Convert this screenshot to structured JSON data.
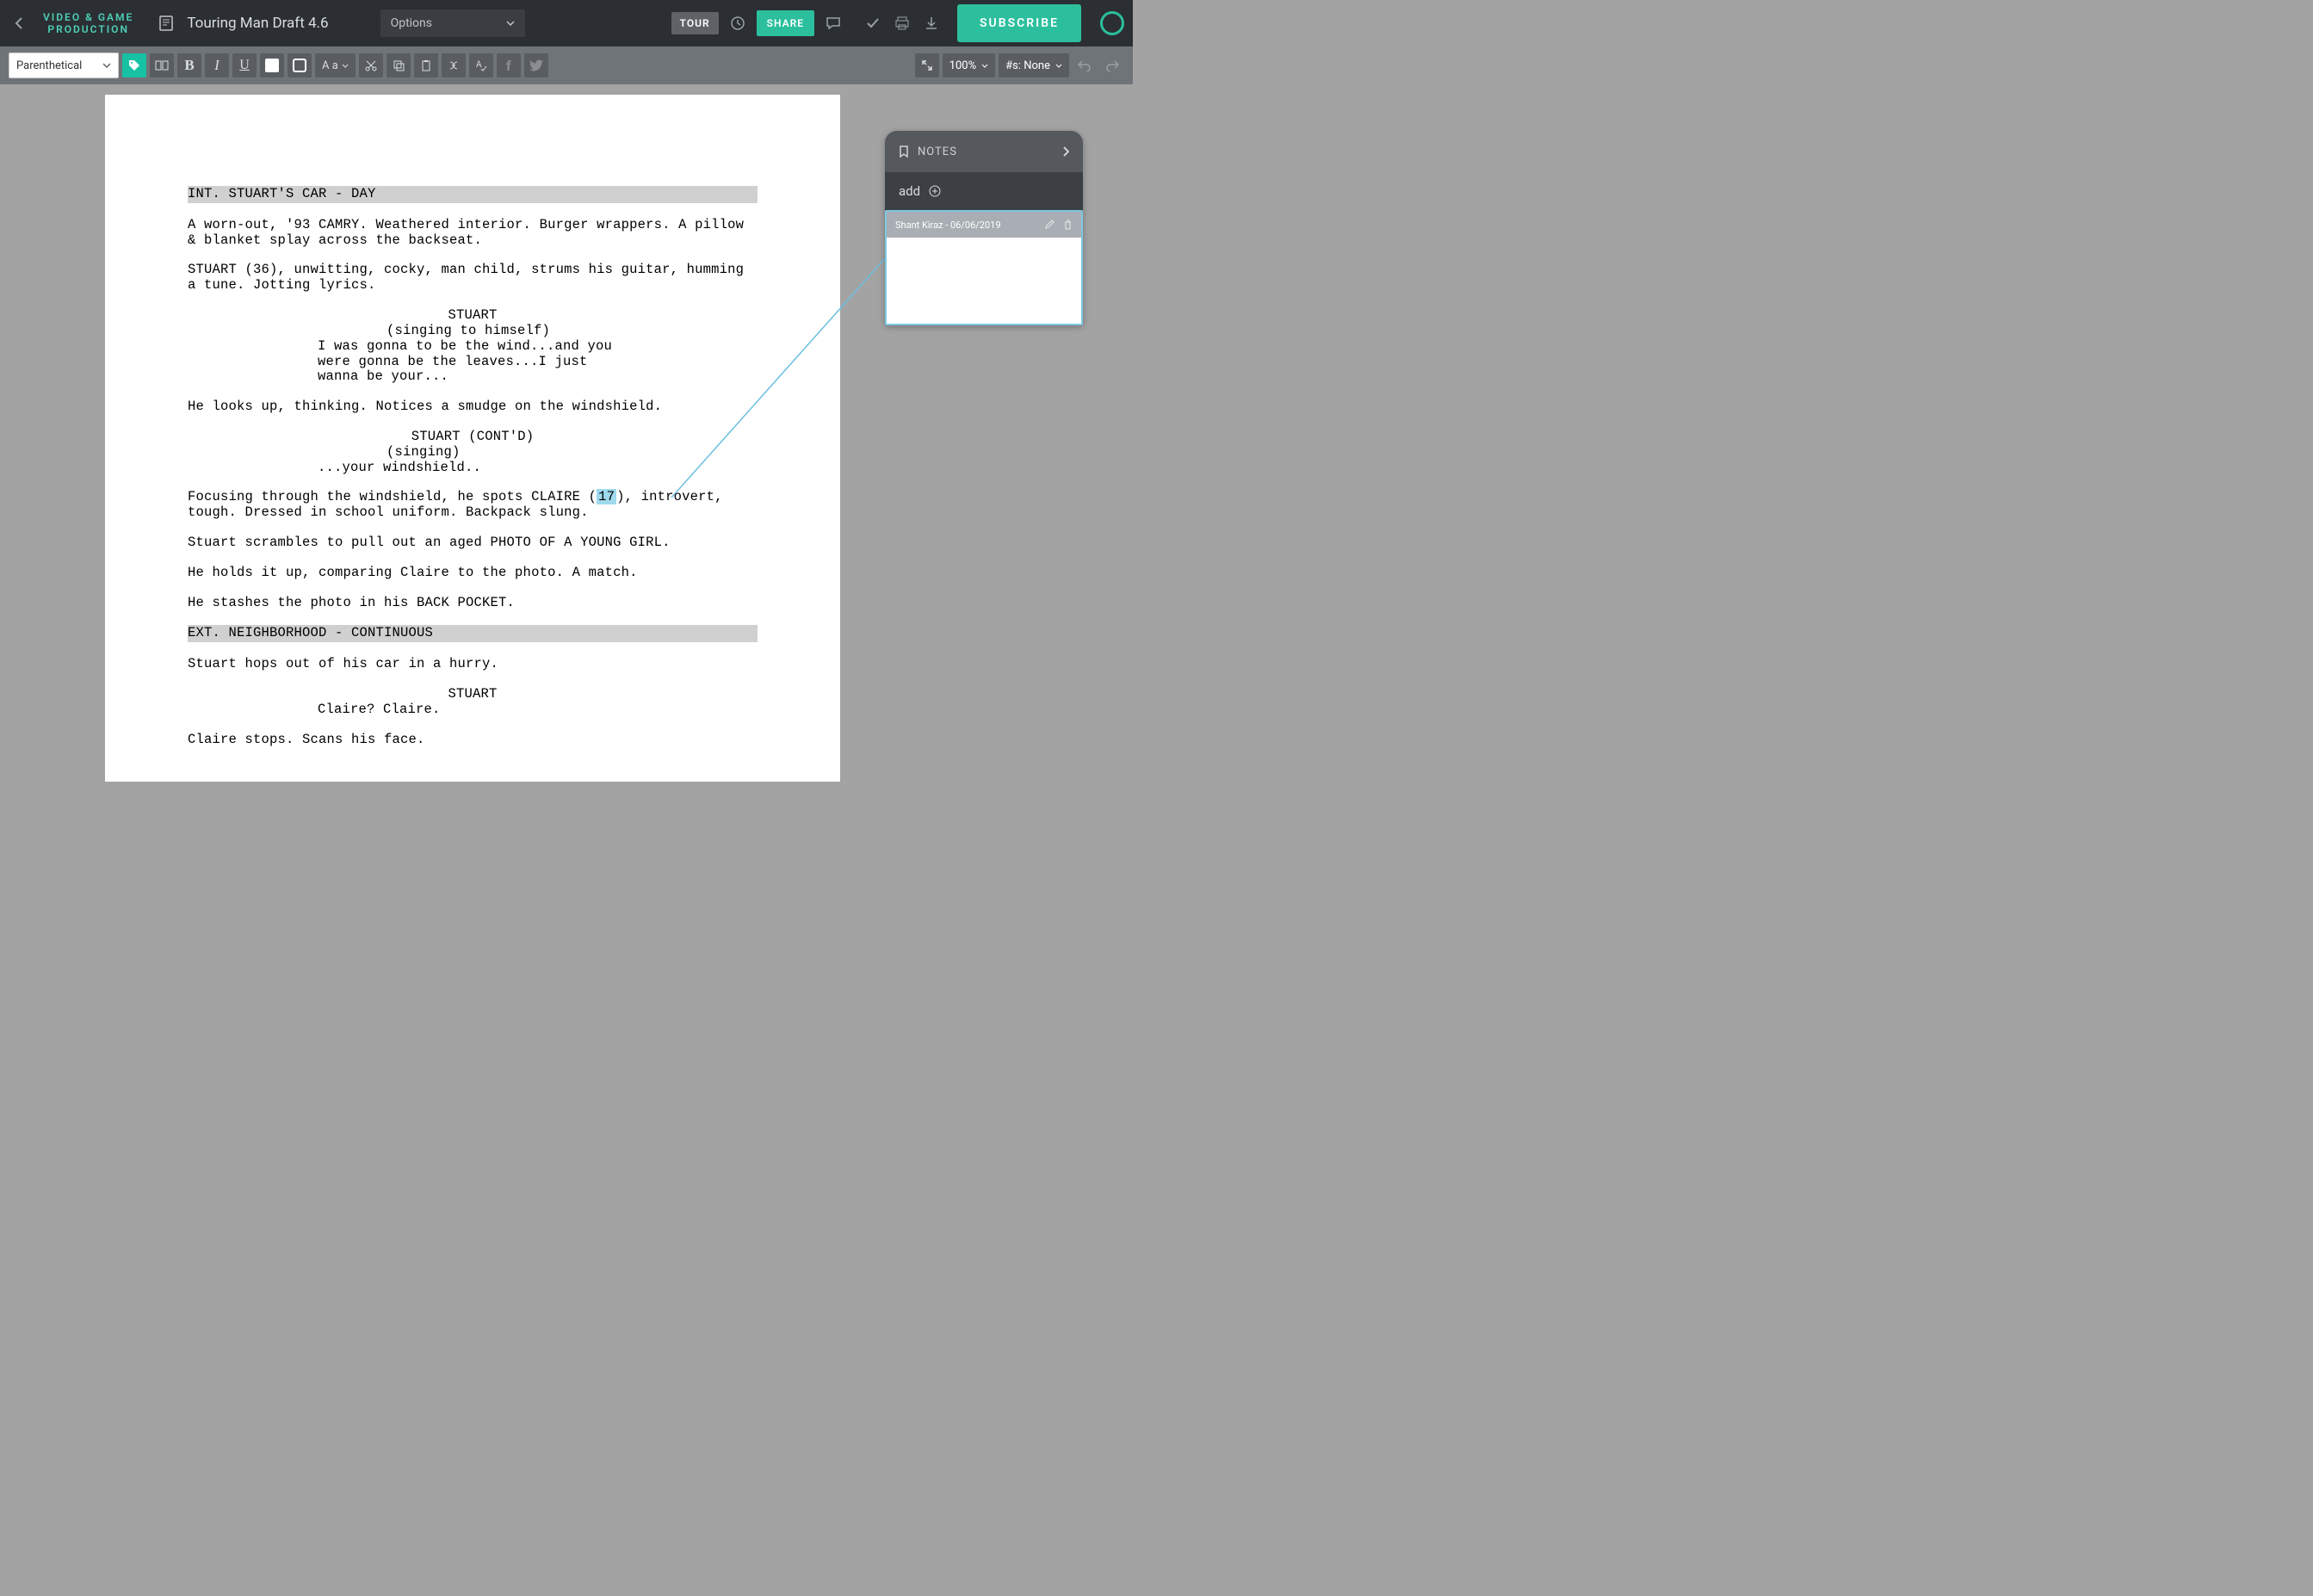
{
  "header": {
    "brand_line1": "VIDEO & GAME",
    "brand_line2": "PRODUCTION",
    "doc_title": "Touring Man Draft 4.6",
    "options_label": "Options",
    "tour_label": "TOUR",
    "share_label": "SHARE",
    "subscribe_label": "SUBSCRIBE"
  },
  "toolbar": {
    "element_type": "Parenthetical",
    "case_label": "A a",
    "zoom": "100%",
    "numbering": "#s: None"
  },
  "notes": {
    "title": "NOTES",
    "add_label": "add",
    "card_meta": "Shant Kiraz - 06/06/2019"
  },
  "script": {
    "slug1": "INT. STUART'S CAR - DAY",
    "a1": "A worn-out, '93 CAMRY. Weathered interior. Burger wrappers. A pillow & blanket splay across the backseat.",
    "a2": "STUART (36), unwitting, cocky, man child, strums his guitar, humming a tune. Jotting lyrics.",
    "c1": "STUART",
    "p1": "(singing to himself)",
    "d1": "I was gonna to be the wind...and you were gonna be the leaves...I just wanna be your...",
    "a3": "He looks up, thinking. Notices a smudge on the windshield.",
    "c2": "STUART (CONT'D)",
    "p2": "(singing)",
    "d2": "...your windshield..",
    "a4a": "Focusing through the windshield, he spots CLAIRE (",
    "a4mark": "17",
    "a4b": "), introvert, tough. Dressed in school uniform. Backpack slung.",
    "a5": "Stuart scrambles to pull out an aged PHOTO OF A YOUNG GIRL.",
    "a6": "He holds it up, comparing Claire to the photo. A match.",
    "a7": "He stashes the photo in his BACK POCKET.",
    "slug2": "EXT. NEIGHBORHOOD - CONTINUOUS",
    "a8": "Stuart hops out of his car in a hurry.",
    "c3": "STUART",
    "d3": "Claire? Claire.",
    "a9": "Claire stops. Scans his face."
  }
}
